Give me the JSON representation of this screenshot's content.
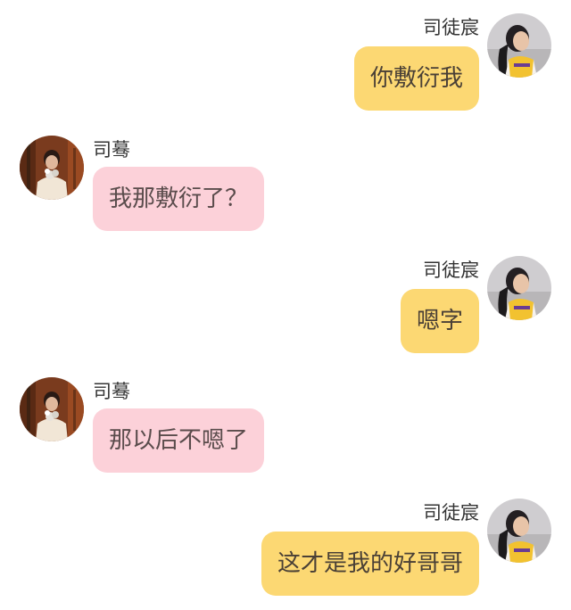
{
  "colors": {
    "sent_bubble": "#fcd873",
    "received_bubble": "#fcd1d9",
    "background": "#ffffff"
  },
  "users": {
    "right": {
      "name": "司徒宸",
      "avatar_icon": "girl-jersey-avatar"
    },
    "left": {
      "name": "司蓦",
      "avatar_icon": "boy-flowers-avatar"
    }
  },
  "messages": [
    {
      "side": "right",
      "name": "司徒宸",
      "text": "你敷衍我"
    },
    {
      "side": "left",
      "name": "司蓦",
      "text": "我那敷衍了？"
    },
    {
      "side": "right",
      "name": "司徒宸",
      "text": "嗯字"
    },
    {
      "side": "left",
      "name": "司蓦",
      "text": "那以后不嗯了"
    },
    {
      "side": "right",
      "name": "司徒宸",
      "text": "这才是我的好哥哥"
    }
  ]
}
